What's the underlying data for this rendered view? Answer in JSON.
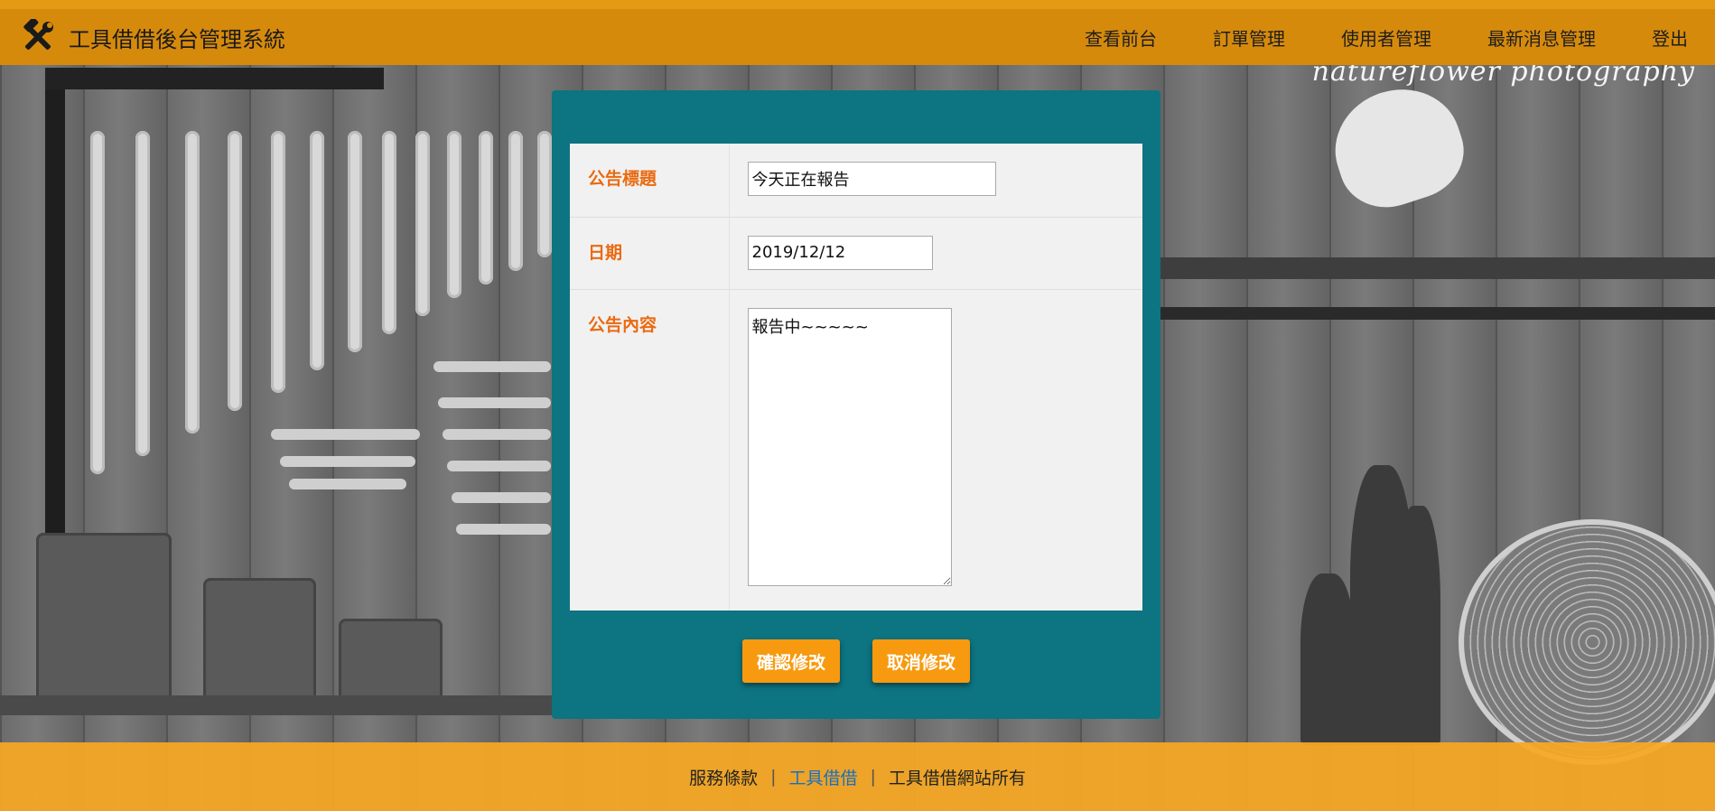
{
  "header": {
    "app_title": "工具借借後台管理系統",
    "logo_icon": "tools-icon",
    "nav": [
      "查看前台",
      "訂單管理",
      "使用者管理",
      "最新消息管理",
      "登出"
    ]
  },
  "background": {
    "watermark": "natureflower photography"
  },
  "form": {
    "title_label": "公告標題",
    "title_value": "今天正在報告",
    "date_label": "日期",
    "date_value": "2019/12/12",
    "content_label": "公告內容",
    "content_value": "報告中~~~~~",
    "confirm_button": "確認修改",
    "cancel_button": "取消修改"
  },
  "footer": {
    "terms": "服務條款",
    "brand_link": "工具借借",
    "copyright": "工具借借網站所有"
  },
  "colors": {
    "header": "#d68a0c",
    "panel": "#0d7481",
    "label": "#ea6a10",
    "button": "#f79a0f",
    "footer": "#f6a822",
    "footer_link": "#1a6fc0"
  }
}
